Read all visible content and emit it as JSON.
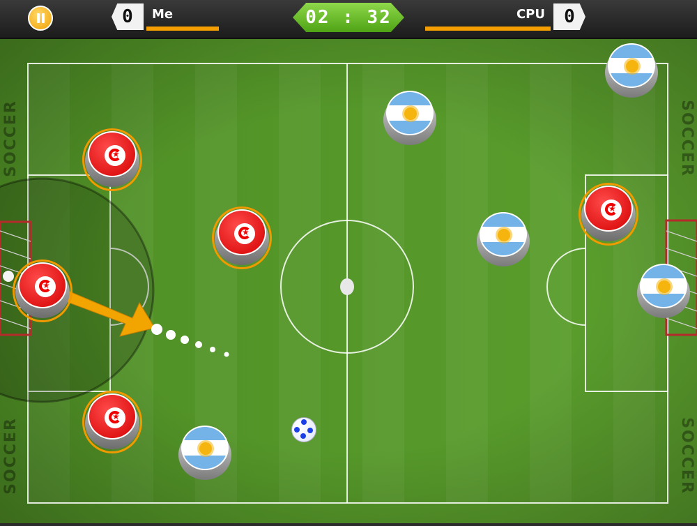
{
  "hud": {
    "player_score": "0",
    "player_name": "Me",
    "cpu_name": "CPU",
    "cpu_score": "0",
    "timer": "02 : 32"
  },
  "field": {
    "side_label": "SOCCER"
  },
  "colors": {
    "grass_light": "#5c9f2e",
    "grass_dark": "#4f8f25",
    "accent_orange": "#f5a000",
    "timer_green": "#6cc02f"
  }
}
